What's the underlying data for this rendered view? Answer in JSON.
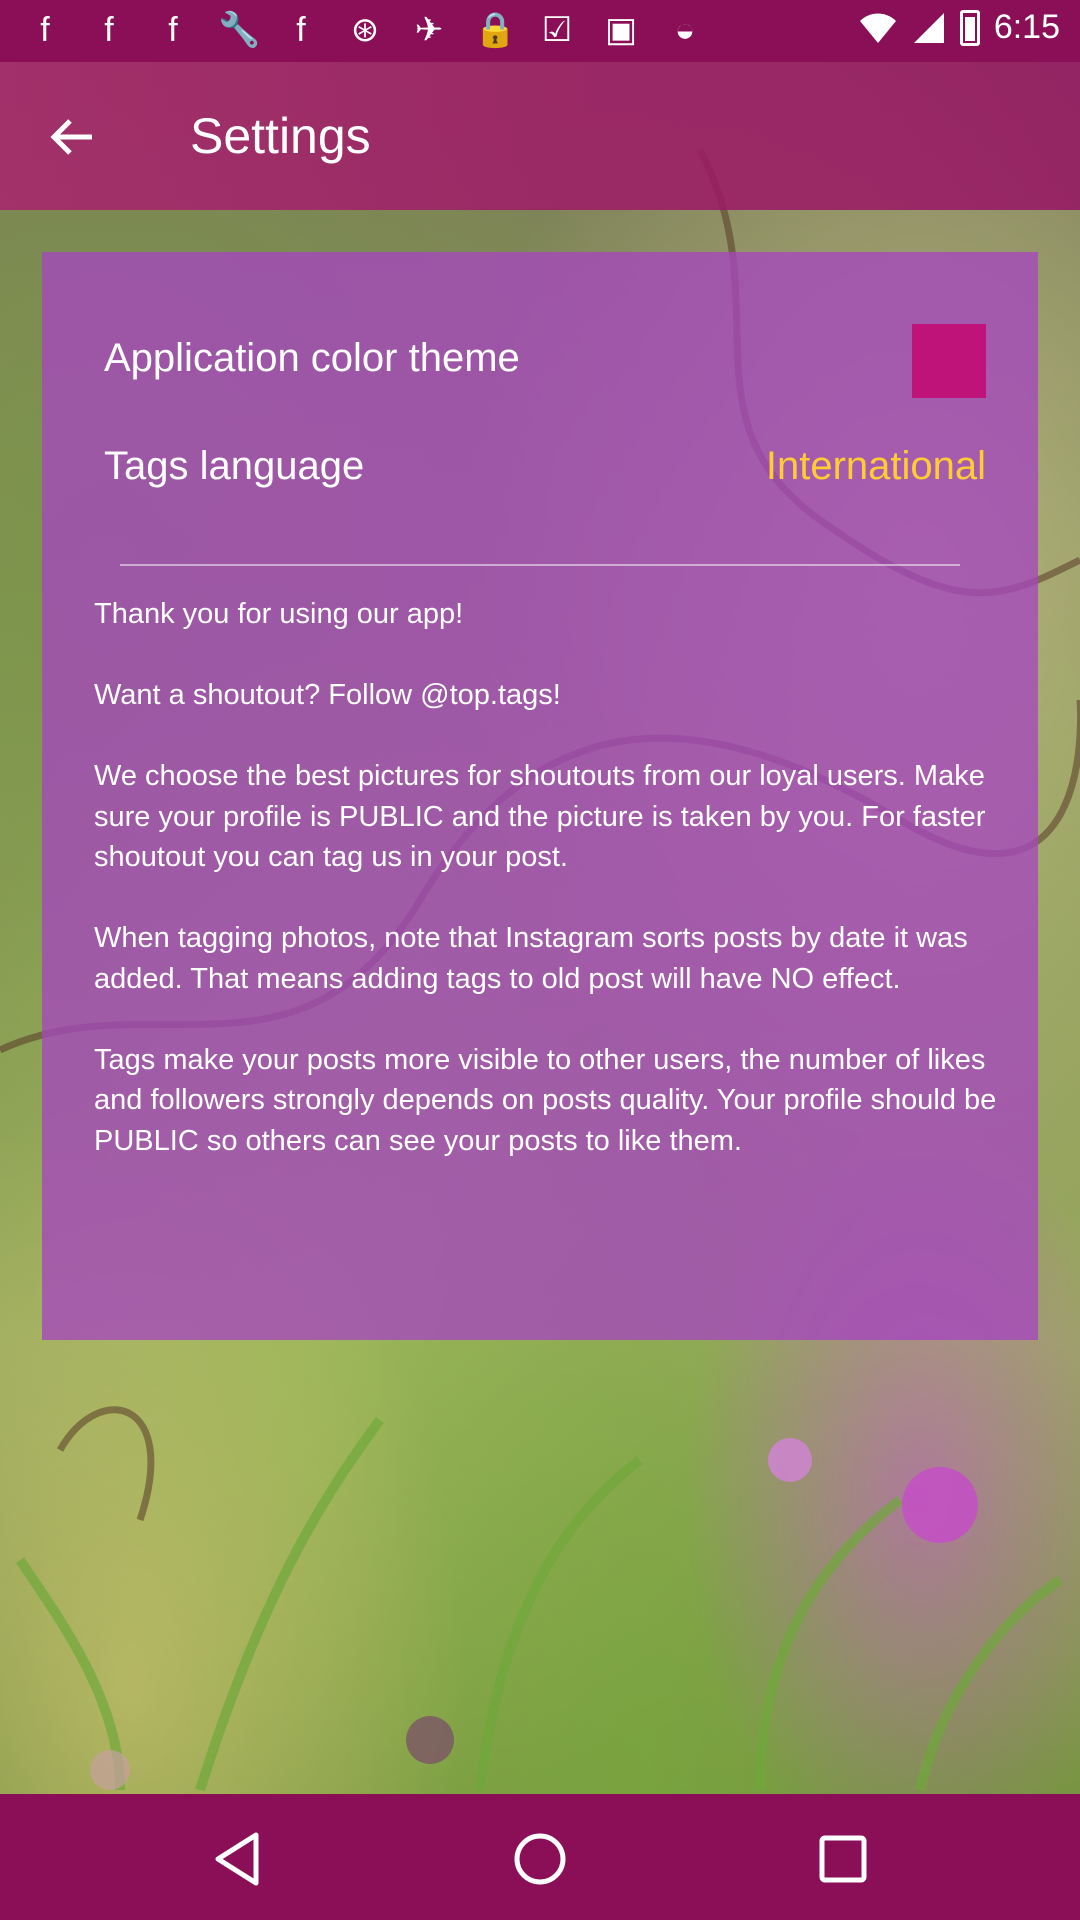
{
  "status_bar": {
    "clock": "6:15",
    "icons": [
      "facebook-icon",
      "facebook-icon",
      "facebook-icon",
      "wrench-icon",
      "facebook-icon",
      "hotspot-icon",
      "fake-gps-icon",
      "lock-icon",
      "inbox-check-icon",
      "briefcase-icon",
      "android-icon"
    ]
  },
  "app_bar": {
    "title": "Settings",
    "back_icon": "arrow-left-icon"
  },
  "settings": {
    "color_theme": {
      "label": "Application color theme",
      "swatch_color": "#c0137a"
    },
    "tags_language": {
      "label": "Tags language",
      "value": "International"
    }
  },
  "info": {
    "paragraphs": [
      "Thank you for using our app!",
      "Want a shoutout? Follow @top.tags!",
      "We choose the best pictures for shoutouts from our loyal users. Make sure your profile is PUBLIC and the picture is taken by you. For faster shoutout you can tag us in your post.",
      "When tagging photos, note that Instagram sorts posts by date it was added. That means adding tags to old post will have NO effect.",
      "Tags make your posts more visible to other users, the number of likes and followers strongly depends on posts quality. Your profile should be PUBLIC so others can see your posts to like them."
    ]
  },
  "colors": {
    "status_bar": "#8a0f57",
    "accent": "#ffcc33",
    "card": "#a546be"
  },
  "nav_bar": {
    "buttons": [
      "back-triangle-icon",
      "home-circle-icon",
      "recents-square-icon"
    ]
  }
}
